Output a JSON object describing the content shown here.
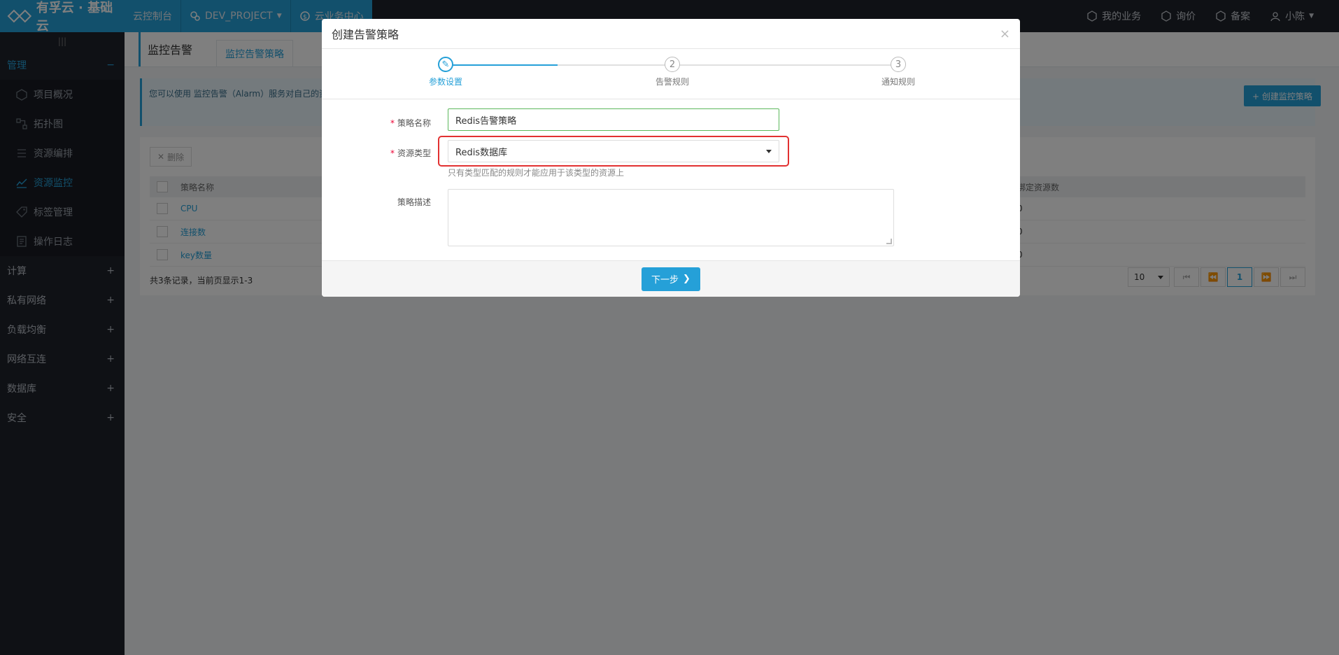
{
  "topbar": {
    "logo": "有孚云 · 基础云",
    "nav": [
      "云控制台",
      "DEV_PROJECT",
      "云业务中心"
    ],
    "right": [
      "我的业务",
      "询价",
      "备案",
      "小陈"
    ]
  },
  "sidebar": {
    "groups": [
      {
        "label": "管理",
        "toggle": "−"
      },
      {
        "label": "计算",
        "toggle": "+"
      },
      {
        "label": "私有网络",
        "toggle": "+"
      },
      {
        "label": "负载均衡",
        "toggle": "+"
      },
      {
        "label": "网络互连",
        "toggle": "+"
      },
      {
        "label": "数据库",
        "toggle": "+"
      },
      {
        "label": "安全",
        "toggle": "+"
      }
    ],
    "items": [
      "项目概况",
      "拓扑图",
      "资源编排",
      "资源监控",
      "标签管理",
      "操作日志"
    ]
  },
  "main": {
    "title": "监控告警",
    "tab": "监控告警策略",
    "notice": "您可以使用 监控告警（Alarm）服务对自己的资源进行监控，需要监控的资源绑定到该策略上，即可令这些资源在规则生效时触发告警。",
    "create_button": "+ 创建监控策略",
    "delete_button": "删除",
    "table": {
      "headers": [
        "策略名称",
        "绑定资源数"
      ],
      "rows": [
        {
          "name": "CPU",
          "count": "0"
        },
        {
          "name": "连接数",
          "count": "0"
        },
        {
          "name": "key数量",
          "count": "0"
        }
      ]
    },
    "footer_info": "共3条记录，当前页显示1-3",
    "page_size": "10",
    "current_page": "1"
  },
  "modal": {
    "title": "创建告警策略",
    "close": "×",
    "steps": [
      {
        "num": "✎",
        "label": "参数设置"
      },
      {
        "num": "2",
        "label": "告警规则"
      },
      {
        "num": "3",
        "label": "通知规则"
      }
    ],
    "form": {
      "name_label": "策略名称",
      "name_value": "Redis告警策略",
      "type_label": "资源类型",
      "type_value": "Redis数据库",
      "type_hint": "只有类型匹配的规则才能应用于该类型的资源上",
      "desc_label": "策略描述",
      "required_mark": "*"
    },
    "next_button": "下一步",
    "next_icon": "❯"
  },
  "colors": {
    "accent": "#25a0d8",
    "highlight": "#e23131",
    "valid": "#5cb85c"
  }
}
